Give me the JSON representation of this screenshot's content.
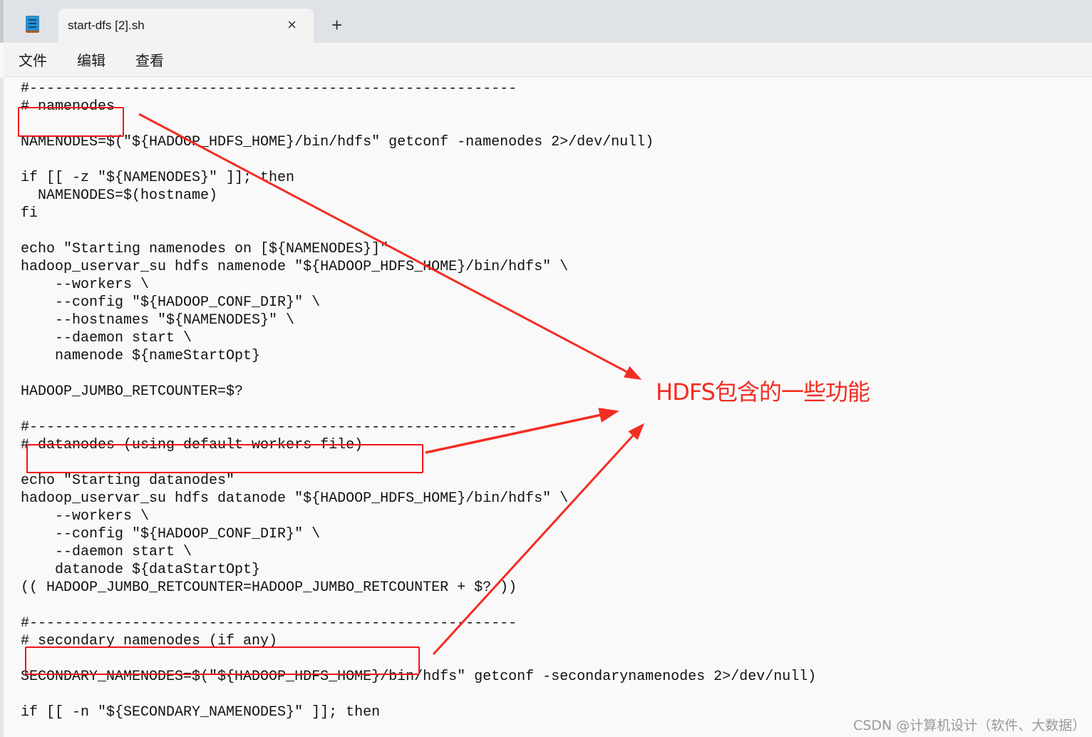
{
  "window": {
    "tab_title": "start-dfs [2].sh",
    "close_icon": "×",
    "new_tab_icon": "+"
  },
  "menu": {
    "items": [
      "文件",
      "编辑",
      "查看"
    ]
  },
  "code_lines": [
    "",
    "",
    "",
    "",
    "#---------------------------------------------------------",
    "# namenodes",
    "",
    "NAMENODES=$(\"${HADOOP_HDFS_HOME}/bin/hdfs\" getconf -namenodes 2>/dev/null)",
    "",
    "if [[ -z \"${NAMENODES}\" ]]; then",
    "  NAMENODES=$(hostname)",
    "fi",
    "",
    "echo \"Starting namenodes on [${NAMENODES}]\"",
    "hadoop_uservar_su hdfs namenode \"${HADOOP_HDFS_HOME}/bin/hdfs\" \\",
    "    --workers \\",
    "    --config \"${HADOOP_CONF_DIR}\" \\",
    "    --hostnames \"${NAMENODES}\" \\",
    "    --daemon start \\",
    "    namenode ${nameStartOpt}",
    "",
    "HADOOP_JUMBO_RETCOUNTER=$?",
    "",
    "#---------------------------------------------------------",
    "# datanodes (using default workers file)",
    "",
    "echo \"Starting datanodes\"",
    "hadoop_uservar_su hdfs datanode \"${HADOOP_HDFS_HOME}/bin/hdfs\" \\",
    "    --workers \\",
    "    --config \"${HADOOP_CONF_DIR}\" \\",
    "    --daemon start \\",
    "    datanode ${dataStartOpt}",
    "(( HADOOP_JUMBO_RETCOUNTER=HADOOP_JUMBO_RETCOUNTER + $? ))",
    "",
    "#---------------------------------------------------------",
    "# secondary namenodes (if any)",
    "",
    "SECONDARY_NAMENODES=$(\"${HADOOP_HDFS_HOME}/bin/hdfs\" getconf -secondarynamenodes 2>/dev/null)",
    "",
    "if [[ -n \"${SECONDARY_NAMENODES}\" ]]; then"
  ],
  "annotation": {
    "label": "HDFS包含的一些功能",
    "color": "#f22d22"
  },
  "watermark": "CSDN @计算机设计（软件、大数据）"
}
